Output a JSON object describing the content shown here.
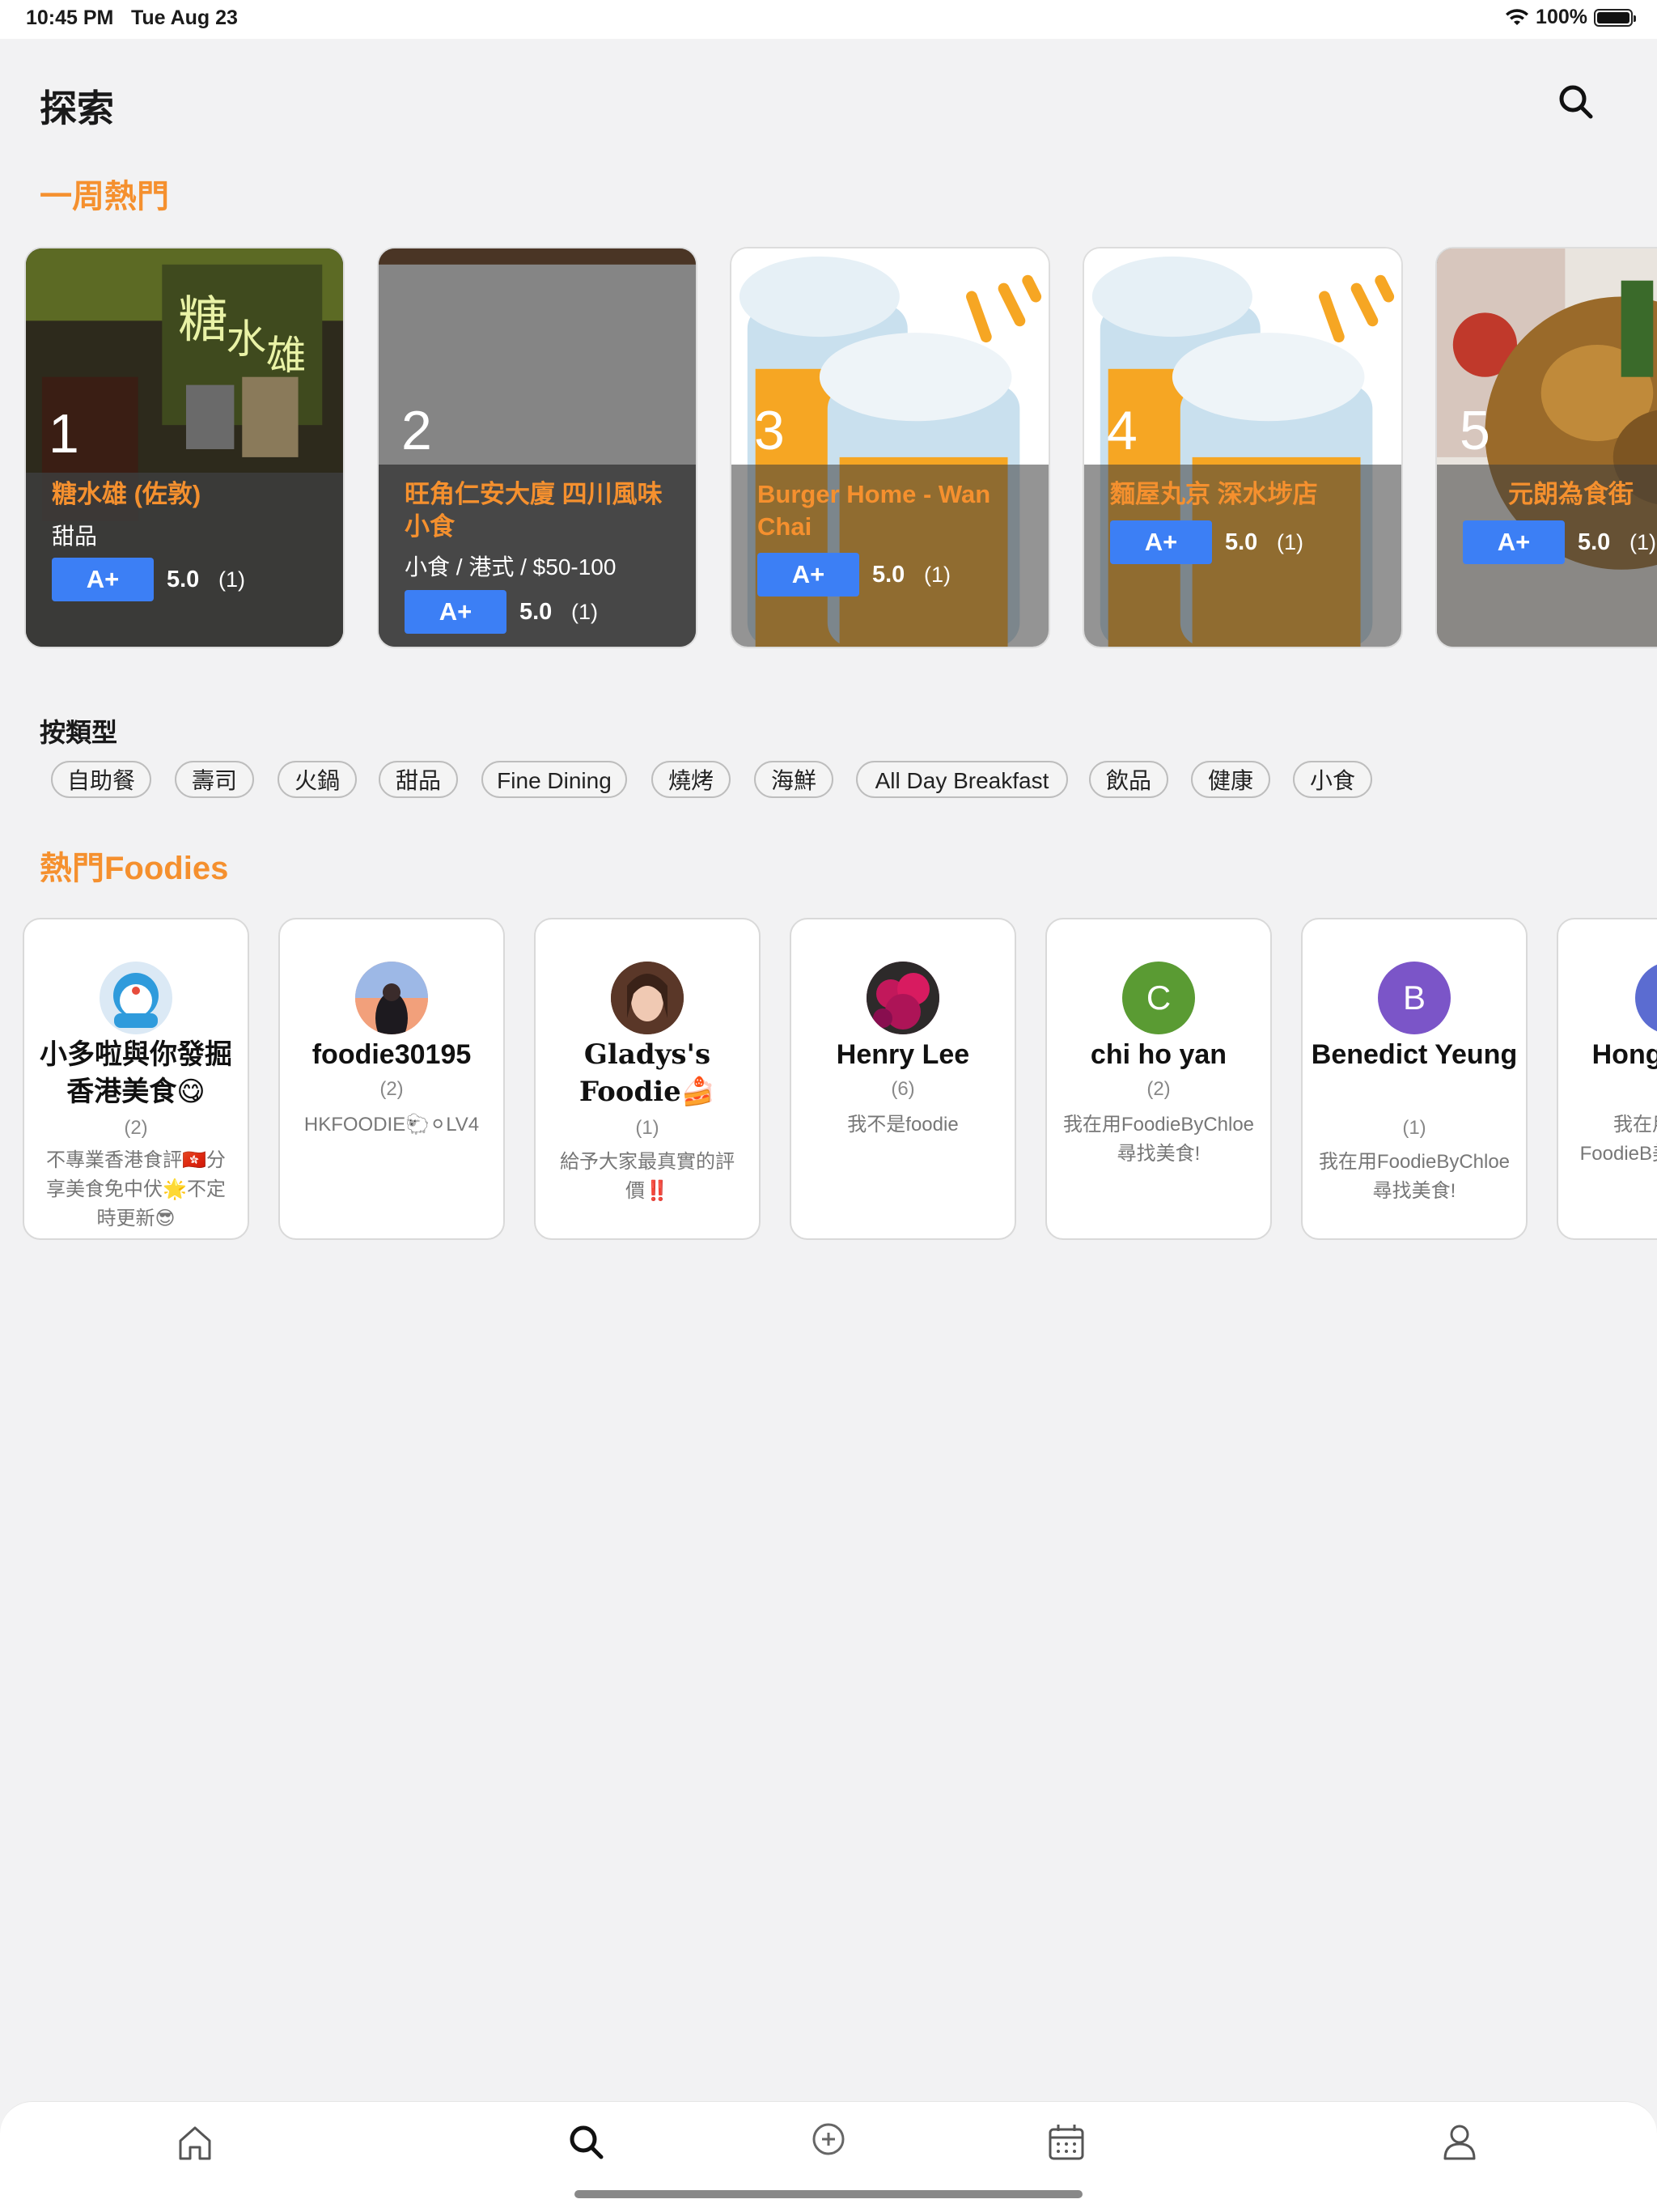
{
  "status_bar": {
    "time": "10:45 PM",
    "date": "Tue Aug 23",
    "battery": "100%"
  },
  "header": {
    "title": "探索",
    "search_icon": "search-icon"
  },
  "trending": {
    "title": "一周熱門",
    "cards": [
      {
        "rank": "1",
        "name": "糖水雄 (佐敦)",
        "sub": "甜品",
        "grade": "A+",
        "score": "5.0",
        "count": "(1)"
      },
      {
        "rank": "2",
        "name": "旺角仁安大廈 四川風味小食",
        "sub": "小食 / 港式 / $50-100",
        "grade": "A+",
        "score": "5.0",
        "count": "(1)"
      },
      {
        "rank": "3",
        "name": "Burger Home - Wan Chai",
        "sub": "",
        "grade": "A+",
        "score": "5.0",
        "count": "(1)"
      },
      {
        "rank": "4",
        "name": "麵屋丸京 深水埗店",
        "sub": "",
        "grade": "A+",
        "score": "5.0",
        "count": "(1)"
      },
      {
        "rank": "5",
        "name": "元朗為食街",
        "sub": "",
        "grade": "A+",
        "score": "5.0",
        "count": "(1)"
      }
    ]
  },
  "categories": {
    "title": "按類型",
    "items": [
      "自助餐",
      "壽司",
      "火鍋",
      "甜品",
      "Fine Dining",
      "燒烤",
      "海鮮",
      "All Day Breakfast",
      "飲品",
      "健康",
      "小食"
    ]
  },
  "foodies": {
    "title": "熱門Foodies",
    "items": [
      {
        "name": "小多啦與你發掘香港美食😋",
        "count": "(2)",
        "bio": "不專業香港食評🇭🇰分享美食免中伏🌟不定時更新😎",
        "initial": "",
        "avatar_color": "#dbe9f5"
      },
      {
        "name": "foodie30195",
        "count": "(2)",
        "bio": "HKFOODIE🐑⚪LV4",
        "initial": "",
        "avatar_color": "#c89a8e"
      },
      {
        "name": "Gladys's Foodie🍰",
        "count": "(1)",
        "bio": "給予大家最真實的評價‼️",
        "initial": "",
        "avatar_color": "#6b4232"
      },
      {
        "name": "Henry Lee",
        "count": "(6)",
        "bio": "我不是foodie",
        "initial": "",
        "avatar_color": "#8b1a5e"
      },
      {
        "name": "chi ho yan",
        "count": "(2)",
        "bio": "我在用FoodieByChloe尋找美食!",
        "initial": "C",
        "avatar_color": "#5a9b33"
      },
      {
        "name": "Benedict Yeung",
        "count": "(1)",
        "bio": "我在用FoodieByChloe尋找美食!",
        "initial": "B",
        "avatar_color": "#7b55c8"
      },
      {
        "name": "Hong Y",
        "count": "",
        "bio": "我在用FoodieB美",
        "initial": "",
        "avatar_color": "#5b6cd1"
      }
    ]
  },
  "tab_bar": {
    "items": [
      "home-icon",
      "search-icon",
      "add-circle-icon",
      "calendar-icon",
      "profile-icon"
    ],
    "active": "search-icon"
  },
  "colors": {
    "accent": "#f5902e",
    "grade_blue": "#3c7ff5",
    "background": "#f2f2f3"
  }
}
